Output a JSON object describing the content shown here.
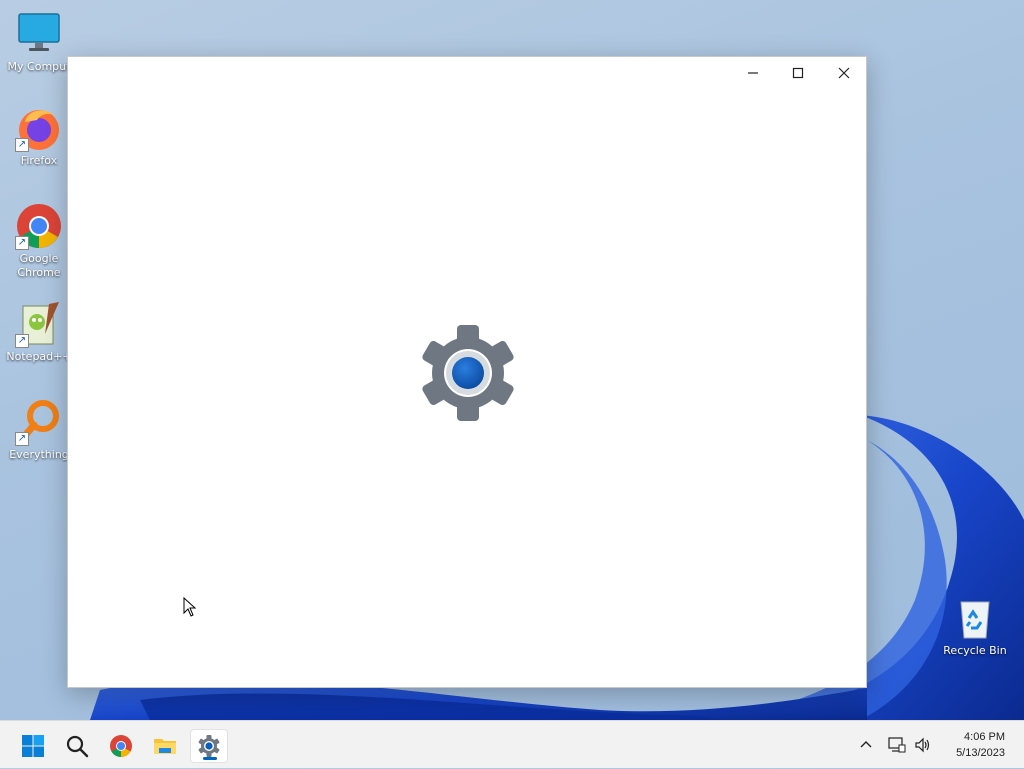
{
  "desktop": {
    "icons": [
      {
        "label": "My Comput",
        "icon": "monitor-icon"
      },
      {
        "label": "Firefox",
        "icon": "firefox-icon"
      },
      {
        "label": "Google Chrome",
        "icon": "chrome-icon"
      },
      {
        "label": "Notepad++",
        "icon": "notepadpp-icon"
      },
      {
        "label": "Everything",
        "icon": "everything-icon"
      },
      {
        "label": "Recycle Bin",
        "icon": "recycle-bin-icon"
      }
    ]
  },
  "window": {
    "app": "Settings",
    "splash_icon": "gear-icon",
    "controls": [
      "minimize",
      "maximize",
      "close"
    ]
  },
  "taskbar": {
    "items": [
      {
        "name": "start",
        "icon": "windows-logo-icon"
      },
      {
        "name": "search",
        "icon": "search-icon"
      },
      {
        "name": "chrome",
        "icon": "chrome-icon"
      },
      {
        "name": "file-explorer",
        "icon": "folder-icon"
      },
      {
        "name": "settings",
        "icon": "gear-icon",
        "active": true
      }
    ],
    "tray": {
      "icons": [
        "chevron-up-icon",
        "network-icon",
        "volume-icon"
      ]
    },
    "clock": {
      "time": "4:06 PM",
      "date": "5/13/2023"
    }
  },
  "colors": {
    "accent": "#0067c0",
    "wallpaper_bloom": "#1d4fd1",
    "window_bg": "#ffffff"
  }
}
